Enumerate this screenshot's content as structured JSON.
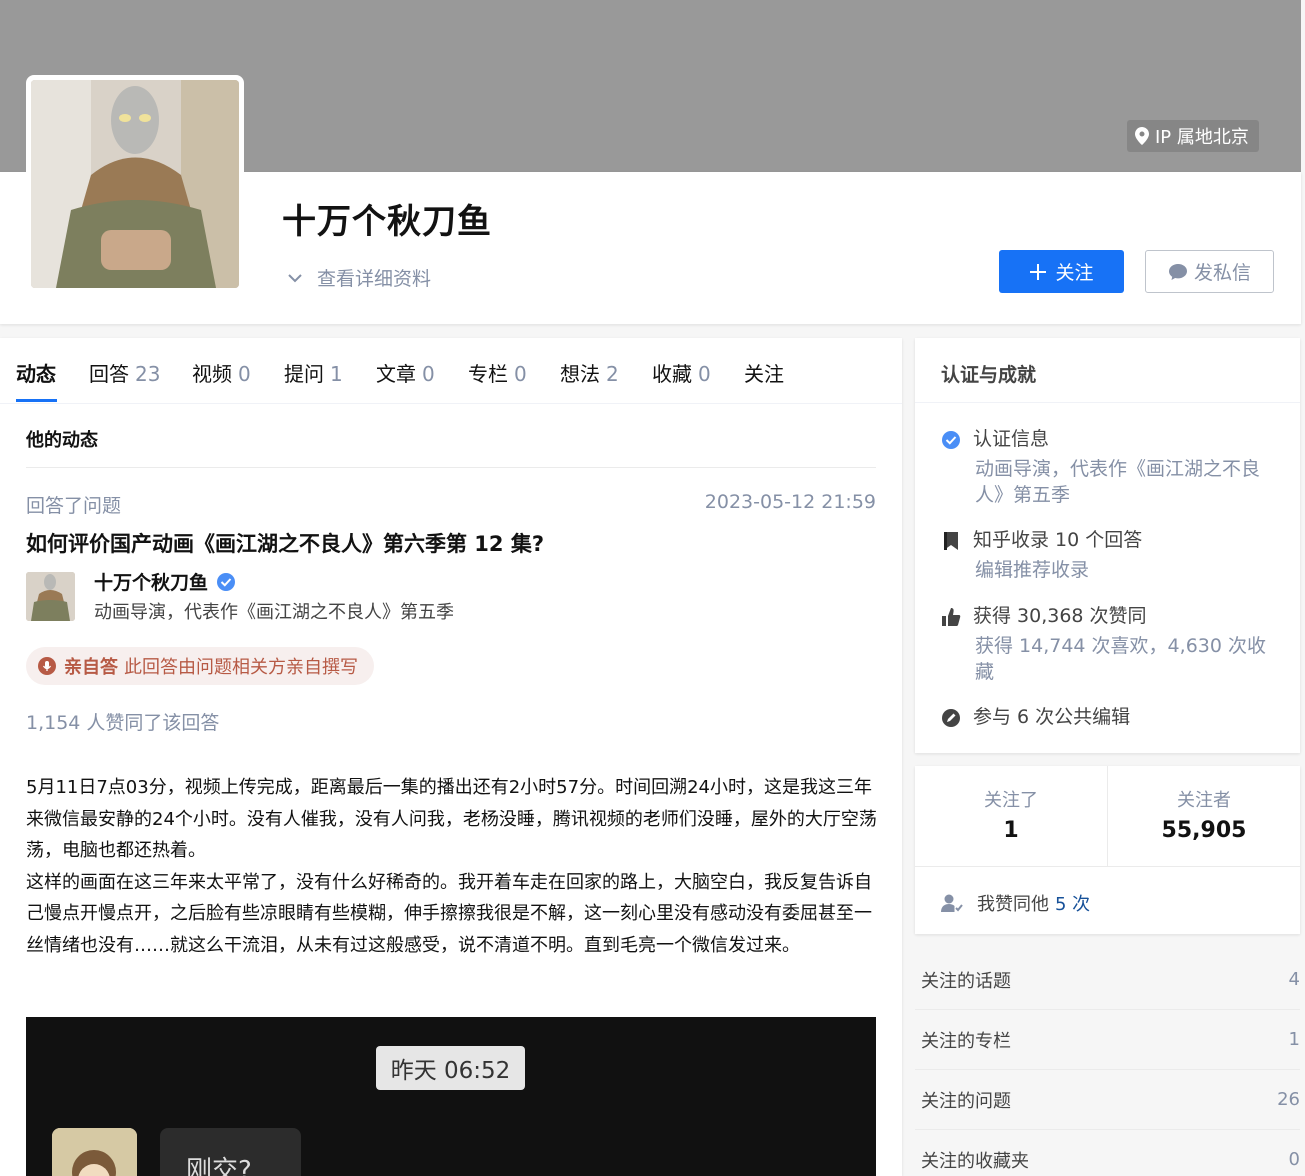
{
  "profile": {
    "ip_location": "IP 属地北京",
    "name": "十万个秋刀鱼",
    "detail_link": "查看详细资料",
    "follow_button": "关注",
    "message_button": "发私信"
  },
  "tabs": [
    {
      "label": "动态",
      "count": ""
    },
    {
      "label": "回答",
      "count": "23"
    },
    {
      "label": "视频",
      "count": "0"
    },
    {
      "label": "提问",
      "count": "1"
    },
    {
      "label": "文章",
      "count": "0"
    },
    {
      "label": "专栏",
      "count": "0"
    },
    {
      "label": "想法",
      "count": "2"
    },
    {
      "label": "收藏",
      "count": "0"
    },
    {
      "label": "关注",
      "count": ""
    }
  ],
  "feed": {
    "section_title": "他的动态",
    "action": "回答了问题",
    "time": "2023-05-12 21:59",
    "question_title": "如何评价国产动画《画江湖之不良人》第六季第 12 集?",
    "author_name": "十万个秋刀鱼",
    "author_bio": "动画导演，代表作《画江湖之不良人》第五季",
    "badge_strong": "亲自答",
    "badge_text": "此回答由问题相关方亲自撰写",
    "votes": "1,154 人赞同了该回答",
    "paragraphs": [
      "5月11日7点03分，视频上传完成，距离最后一集的播出还有2小时57分。时间回溯24小时，这是我这三年来微信最安静的24个小时。没有人催我，没有人问我，老杨没睡，腾讯视频的老师们没睡，屋外的大厅空荡荡，电脑也都还热着。",
      "这样的画面在这三年来太平常了，没有什么好稀奇的。我开着车走在回家的路上，大脑空白，我反复告诉自己慢点开慢点开，之后脸有些凉眼睛有些模糊，伸手擦擦我很是不解，这一刻心里没有感动没有委屈甚至一丝情绪也没有……就这么干流泪，从未有过这般感受，说不清道不明。直到毛亮一个微信发过来。"
    ],
    "image_chat_time": "昨天 06:52",
    "image_chat_text": "刚交?"
  },
  "achievements": {
    "title": "认证与成就",
    "items": [
      {
        "icon": "verified-icon",
        "text": "认证信息",
        "sub": "动画导演，代表作《画江湖之不良人》第五季"
      },
      {
        "icon": "bookmark-icon",
        "text": "知乎收录 10 个回答",
        "sub": "编辑推荐收录"
      },
      {
        "icon": "thumb-up-icon",
        "text": "获得 30,368 次赞同",
        "sub": "获得 14,744 次喜欢，4,630 次收藏"
      },
      {
        "icon": "edit-icon",
        "text": "参与 6 次公共编辑",
        "sub": ""
      }
    ]
  },
  "follow": {
    "following_label": "关注了",
    "following_count": "1",
    "followers_label": "关注者",
    "followers_count": "55,905",
    "agree_prefix": "我赞同他",
    "agree_count": "5 次"
  },
  "stats": [
    {
      "label": "关注的话题",
      "value": "4"
    },
    {
      "label": "关注的专栏",
      "value": "1"
    },
    {
      "label": "关注的问题",
      "value": "26"
    },
    {
      "label": "关注的收藏夹",
      "value": "0"
    }
  ],
  "colors": {
    "accent": "#1772f6",
    "muted": "#8590a6",
    "badge": "#b75a45"
  }
}
